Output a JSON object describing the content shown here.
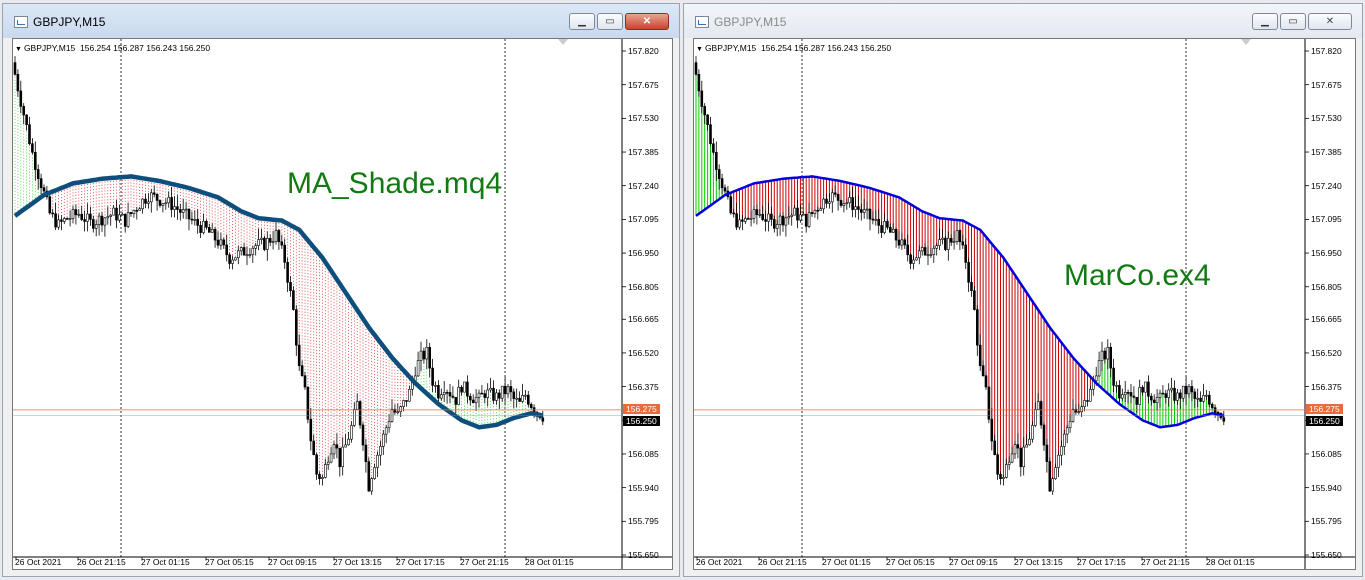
{
  "colors": {
    "bull": "#00cc00",
    "bear": "#cc0000",
    "ma_left": "#0d4e7c",
    "ma_right": "#0000dd",
    "last_price": "#e86c3a"
  },
  "windows": [
    {
      "id": "left",
      "title": "GBPJPY,M15",
      "info": {
        "symbol": "GBPJPY,M15",
        "open": "156.254",
        "high": "156.287",
        "low": "156.243",
        "close": "156.250"
      },
      "overlay_label": "MA_Shade.mq4",
      "price_labels": [
        "157.820",
        "157.675",
        "157.530",
        "157.385",
        "157.240",
        "157.095",
        "156.950",
        "156.805",
        "156.665",
        "156.520",
        "156.375",
        "156.230",
        "156.085",
        "155.940",
        "155.795",
        "155.650"
      ],
      "time_labels": [
        "26 Oct 2021",
        "26 Oct 21:15",
        "27 Oct 01:15",
        "27 Oct 05:15",
        "27 Oct 09:15",
        "27 Oct 13:15",
        "27 Oct 17:15",
        "27 Oct 21:15",
        "28 Oct 01:15"
      ],
      "ask_tag": "156.275",
      "bid_tag": "156.250",
      "shade": "dotted",
      "buttons": {
        "minimize": "minimize",
        "maximize": "maximize",
        "close": "close"
      }
    },
    {
      "id": "right",
      "title": "GBPJPY,M15",
      "info": {
        "symbol": "GBPJPY,M15",
        "open": "156.254",
        "high": "156.287",
        "low": "156.243",
        "close": "156.250"
      },
      "overlay_label": "MarCo.ex4",
      "price_labels": [
        "157.820",
        "157.675",
        "157.530",
        "157.385",
        "157.240",
        "157.095",
        "156.950",
        "156.805",
        "156.665",
        "156.520",
        "156.375",
        "156.230",
        "156.085",
        "155.940",
        "155.795",
        "155.650"
      ],
      "time_labels": [
        "26 Oct 2021",
        "26 Oct 21:15",
        "27 Oct 01:15",
        "27 Oct 05:15",
        "27 Oct 09:15",
        "27 Oct 13:15",
        "27 Oct 17:15",
        "27 Oct 21:15",
        "28 Oct 01:15"
      ],
      "ask_tag": "156.275",
      "bid_tag": "156.250",
      "shade": "solid",
      "buttons": {
        "minimize": "minimize",
        "maximize": "maximize",
        "close": "close"
      }
    }
  ],
  "chart_data": {
    "type": "candlestick",
    "symbol": "GBPJPY",
    "timeframe": "M15",
    "y_range": [
      155.65,
      157.82
    ],
    "last_close": 156.25,
    "ask": 156.275,
    "ma_series": [
      [
        0,
        157.11
      ],
      [
        10,
        157.2
      ],
      [
        20,
        157.25
      ],
      [
        30,
        157.27
      ],
      [
        40,
        157.28
      ],
      [
        50,
        157.26
      ],
      [
        60,
        157.23
      ],
      [
        70,
        157.19
      ],
      [
        78,
        157.13
      ],
      [
        84,
        157.1
      ],
      [
        92,
        157.09
      ],
      [
        98,
        157.05
      ],
      [
        106,
        156.93
      ],
      [
        114,
        156.78
      ],
      [
        122,
        156.63
      ],
      [
        130,
        156.5
      ],
      [
        138,
        156.39
      ],
      [
        146,
        156.3
      ],
      [
        154,
        156.23
      ],
      [
        160,
        156.2
      ],
      [
        166,
        156.21
      ],
      [
        172,
        156.24
      ],
      [
        178,
        156.26
      ],
      [
        182,
        156.25
      ]
    ],
    "close_series": [
      [
        0,
        157.72
      ],
      [
        3,
        157.55
      ],
      [
        6,
        157.38
      ],
      [
        9,
        157.25
      ],
      [
        12,
        157.12
      ],
      [
        15,
        157.07
      ],
      [
        18,
        157.1
      ],
      [
        22,
        157.12
      ],
      [
        26,
        157.08
      ],
      [
        30,
        157.1
      ],
      [
        34,
        157.12
      ],
      [
        38,
        157.09
      ],
      [
        42,
        157.15
      ],
      [
        46,
        157.2
      ],
      [
        50,
        157.18
      ],
      [
        54,
        157.16
      ],
      [
        58,
        157.12
      ],
      [
        62,
        157.08
      ],
      [
        66,
        157.05
      ],
      [
        70,
        157.0
      ],
      [
        74,
        156.93
      ],
      [
        78,
        156.95
      ],
      [
        82,
        156.98
      ],
      [
        86,
        156.99
      ],
      [
        90,
        157.03
      ],
      [
        93,
        156.92
      ],
      [
        96,
        156.7
      ],
      [
        98,
        156.45
      ],
      [
        100,
        156.35
      ],
      [
        102,
        156.15
      ],
      [
        104,
        156.0
      ],
      [
        106,
        155.98
      ],
      [
        108,
        156.08
      ],
      [
        110,
        156.15
      ],
      [
        112,
        156.05
      ],
      [
        114,
        156.12
      ],
      [
        116,
        156.2
      ],
      [
        118,
        156.3
      ],
      [
        120,
        156.15
      ],
      [
        122,
        155.95
      ],
      [
        124,
        156.05
      ],
      [
        126,
        156.12
      ],
      [
        128,
        156.2
      ],
      [
        130,
        156.28
      ],
      [
        132,
        156.25
      ],
      [
        134,
        156.3
      ],
      [
        136,
        156.35
      ],
      [
        138,
        156.45
      ],
      [
        140,
        156.5
      ],
      [
        142,
        156.52
      ],
      [
        144,
        156.4
      ],
      [
        146,
        156.35
      ],
      [
        148,
        156.38
      ],
      [
        150,
        156.35
      ],
      [
        152,
        156.32
      ],
      [
        154,
        156.38
      ],
      [
        156,
        156.35
      ],
      [
        158,
        156.33
      ],
      [
        160,
        156.32
      ],
      [
        162,
        156.35
      ],
      [
        164,
        156.34
      ],
      [
        166,
        156.33
      ],
      [
        168,
        156.35
      ],
      [
        170,
        156.36
      ],
      [
        172,
        156.32
      ],
      [
        174,
        156.3
      ],
      [
        176,
        156.34
      ],
      [
        178,
        156.3
      ],
      [
        180,
        156.27
      ],
      [
        182,
        156.25
      ]
    ]
  }
}
